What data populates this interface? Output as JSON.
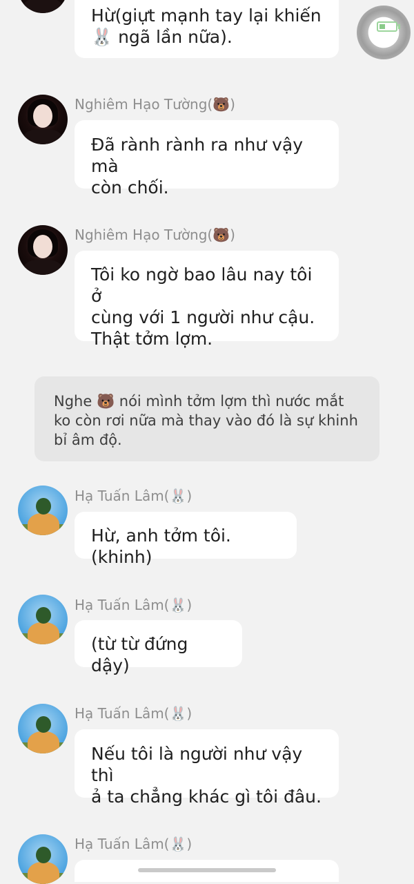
{
  "messages": [
    {
      "text": "Hừ(giựt mạnh tay lại khiến\n🐰 ngã lần nữa)."
    },
    {
      "sender": "Nghiêm Hạo Tường(🐻)",
      "text": "Đã rành rành ra như vậy mà\ncòn chối."
    },
    {
      "sender": "Nghiêm Hạo Tường(🐻)",
      "text": "Tôi ko ngờ bao lâu nay tôi ở\ncùng với 1 người như cậu.\nThật tởm lợm."
    },
    {
      "sender": "Hạ Tuấn Lâm(🐰)",
      "text": "Hừ, anh tởm tôi.(khinh)"
    },
    {
      "sender": "Hạ Tuấn Lâm(🐰)",
      "text": "(từ từ đứng dậy)"
    },
    {
      "sender": "Hạ Tuấn Lâm(🐰)",
      "text": "Nếu tôi là người như vậy thì\nả ta chẳng khác gì tôi đâu."
    },
    {
      "sender": "Hạ Tuấn Lâm(🐰)",
      "text": ""
    }
  ],
  "narration": "Nghe 🐻 nói mình tởm lợm thì nước mắt\nko còn rơi nữa mà thay vào đó là sự khinh\nbỉ âm độ.",
  "colors": {
    "background": "#f2f2f2",
    "bubble": "#ffffff",
    "narration_bg": "#e6e6e6",
    "name_text": "#8e8e8e"
  }
}
